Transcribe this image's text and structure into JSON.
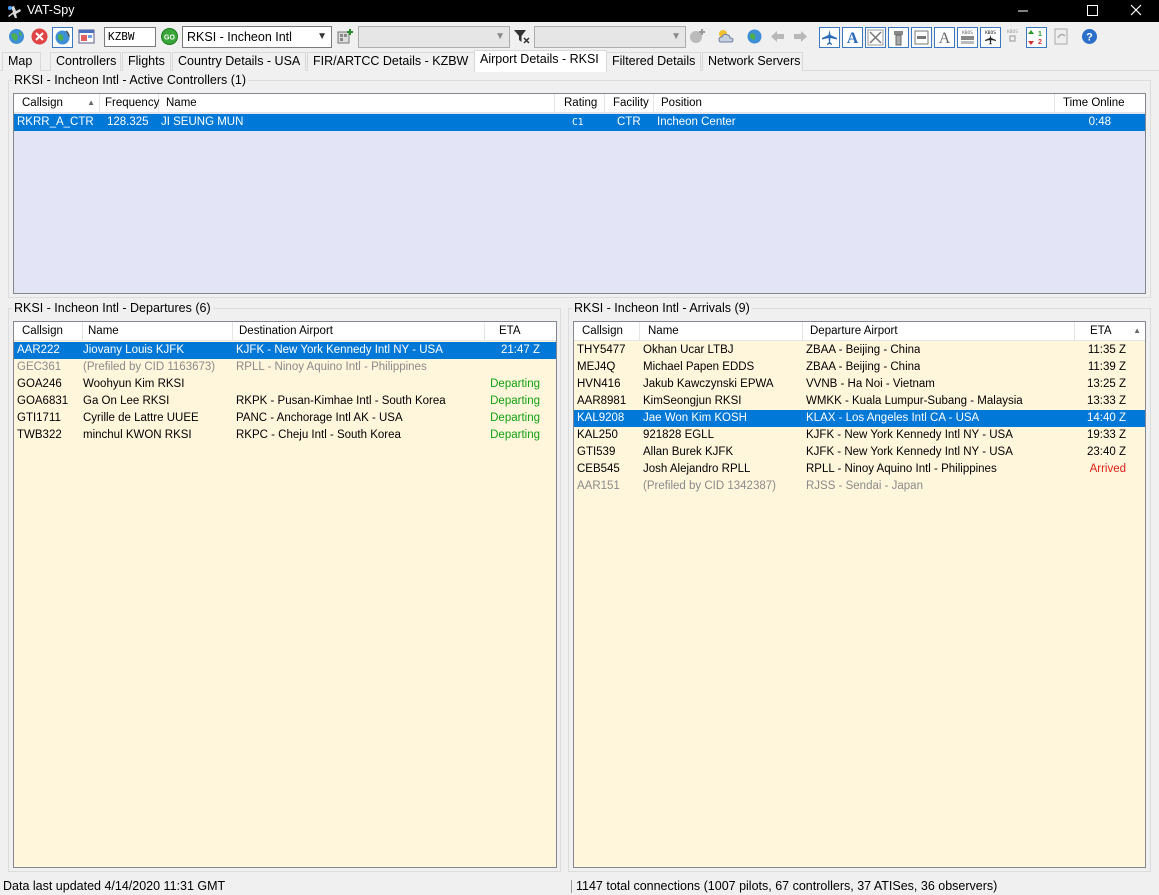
{
  "window": {
    "title": "VAT-Spy"
  },
  "toolbar": {
    "icao_value": "KZBW",
    "airport_combo_value": "RKSI - Incheon Intl",
    "filter_combo_1_value": "",
    "filter_combo_2_value": "",
    "go_label": "GO"
  },
  "tabs": [
    {
      "label": "Map"
    },
    {
      "label": "Controllers"
    },
    {
      "label": "Flights"
    },
    {
      "label": "Country Details - USA"
    },
    {
      "label": "FIR/ARTCC Details - KZBW"
    },
    {
      "label": "Airport Details - RKSI",
      "active": true
    },
    {
      "label": "Filtered Details"
    },
    {
      "label": "Network Servers"
    }
  ],
  "controllers": {
    "title": "RKSI - Incheon Intl - Active Controllers (1)",
    "columns": [
      "Callsign",
      "Frequency",
      "Name",
      "Rating",
      "Facility",
      "Position",
      "Time Online"
    ],
    "rows": [
      {
        "callsign": "RKRR_A_CTR",
        "frequency": "128.325",
        "name": "JI SEUNG MUN",
        "rating": "C1",
        "facility": "CTR",
        "position": "Incheon Center",
        "time_online": "0:48",
        "selected": true
      }
    ]
  },
  "departures": {
    "title": "RKSI - Incheon Intl - Departures (6)",
    "columns": [
      "Callsign",
      "Name",
      "Destination Airport",
      "ETA"
    ],
    "rows": [
      {
        "callsign": "AAR222",
        "name": "Jiovany Louis KJFK",
        "airport": "KJFK - New York Kennedy Intl NY - USA",
        "eta": "21:47 Z",
        "style": "selected"
      },
      {
        "callsign": "GEC361",
        "name": "(Prefiled by CID 1163673)",
        "airport": "RPLL - Ninoy Aquino Intl - Philippines",
        "eta": "",
        "style": "gray"
      },
      {
        "callsign": "GOA246",
        "name": "Woohyun Kim RKSI",
        "airport": "",
        "eta": "Departing",
        "style": "departing"
      },
      {
        "callsign": "GOA6831",
        "name": "Ga On Lee RKSI",
        "airport": "RKPK - Pusan-Kimhae Intl - South Korea",
        "eta": "Departing",
        "style": "departing"
      },
      {
        "callsign": "GTI1711",
        "name": "Cyrille de Lattre UUEE",
        "airport": "PANC - Anchorage Intl AK - USA",
        "eta": "Departing",
        "style": "departing"
      },
      {
        "callsign": "TWB322",
        "name": "minchul KWON RKSI",
        "airport": "RKPC - Cheju Intl - South Korea",
        "eta": "Departing",
        "style": "departing"
      }
    ]
  },
  "arrivals": {
    "title": "RKSI - Incheon Intl - Arrivals (9)",
    "columns": [
      "Callsign",
      "Name",
      "Departure Airport",
      "ETA"
    ],
    "rows": [
      {
        "callsign": "THY5477",
        "name": "Okhan Ucar LTBJ",
        "airport": "ZBAA - Beijing - China",
        "eta": "11:35 Z",
        "style": ""
      },
      {
        "callsign": "MEJ4Q",
        "name": "Michael Papen EDDS",
        "airport": "ZBAA - Beijing - China",
        "eta": "11:39 Z",
        "style": ""
      },
      {
        "callsign": "HVN416",
        "name": "Jakub Kawczynski EPWA",
        "airport": "VVNB - Ha Noi - Vietnam",
        "eta": "13:25 Z",
        "style": ""
      },
      {
        "callsign": "AAR8981",
        "name": "KimSeongjun RKSI",
        "airport": "WMKK - Kuala Lumpur-Subang - Malaysia",
        "eta": "13:33 Z",
        "style": ""
      },
      {
        "callsign": "KAL9208",
        "name": "Jae Won Kim KOSH",
        "airport": "KLAX - Los Angeles Intl CA - USA",
        "eta": "14:40 Z",
        "style": "selected"
      },
      {
        "callsign": "KAL250",
        "name": "921828 EGLL",
        "airport": "KJFK - New York Kennedy Intl NY - USA",
        "eta": "19:33 Z",
        "style": ""
      },
      {
        "callsign": "GTI539",
        "name": "Allan Burek KJFK",
        "airport": "KJFK - New York Kennedy Intl NY - USA",
        "eta": "23:40 Z",
        "style": ""
      },
      {
        "callsign": "CEB545",
        "name": "Josh Alejandro RPLL",
        "airport": "RPLL - Ninoy Aquino Intl - Philippines",
        "eta": "Arrived",
        "style": "arrived"
      },
      {
        "callsign": "AAR151",
        "name": "(Prefiled by CID 1342387)",
        "airport": "RJSS - Sendai - Japan",
        "eta": "",
        "style": "gray"
      }
    ]
  },
  "status": {
    "left": "Data last updated 4/14/2020 11:31 GMT",
    "right": "1147 total connections (1007 pilots, 67 controllers, 37 ATISes, 36 observers)"
  },
  "colors": {
    "selection": "#0078d7",
    "controllers_bg": "#e4e4f7",
    "list_bg": "#fff6dc",
    "departing": "#11a011",
    "arrived": "#e0201a"
  }
}
